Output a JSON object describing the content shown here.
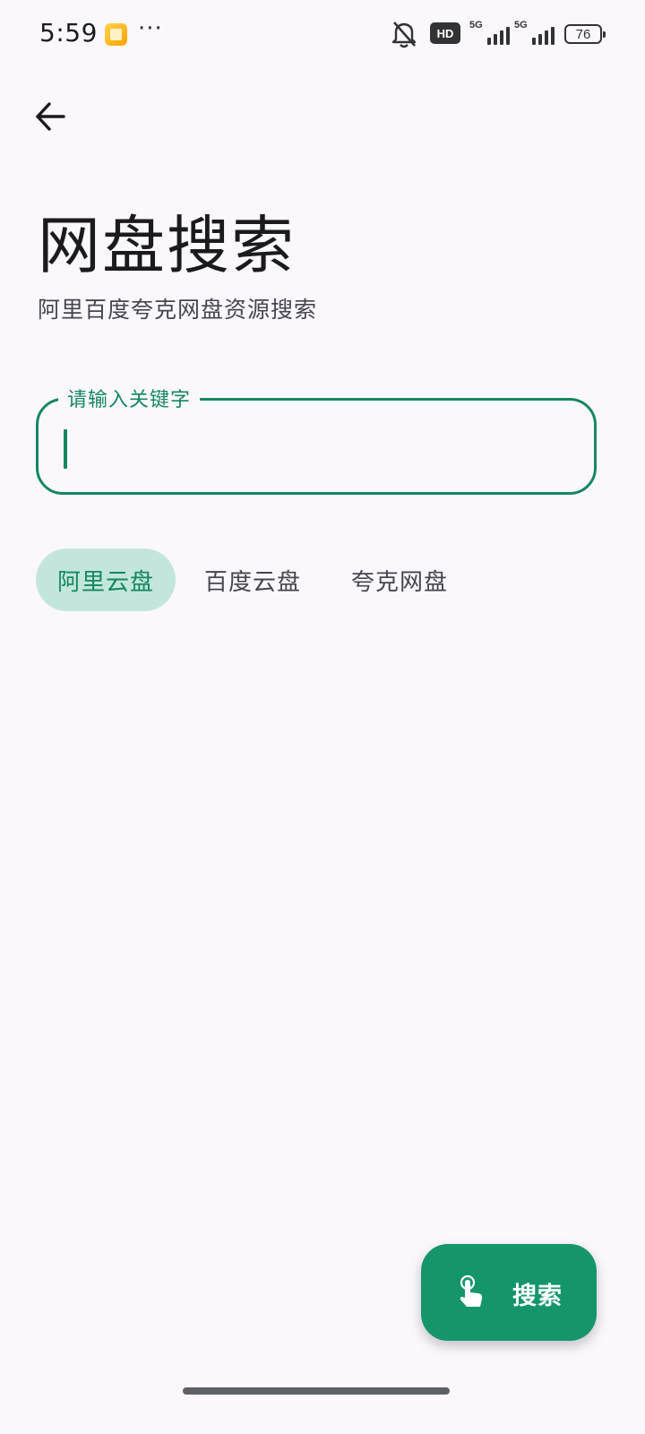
{
  "status_bar": {
    "time": "5:59",
    "more": "···",
    "hd_label": "HD",
    "signal1_label": "5G",
    "signal2_label": "5G",
    "battery_level": "76"
  },
  "header": {
    "back_icon": "arrow-left-icon",
    "title": "网盘搜索",
    "subtitle": "阿里百度夸克网盘资源搜索"
  },
  "search": {
    "label": "请输入关键字",
    "value": ""
  },
  "filters": {
    "selected": "阿里云盘",
    "items": [
      {
        "label": "阿里云盘",
        "selected": true
      },
      {
        "label": "百度云盘",
        "selected": false
      },
      {
        "label": "夸克网盘",
        "selected": false
      }
    ]
  },
  "fab": {
    "icon": "touch-hand-icon",
    "label": "搜索"
  },
  "colors": {
    "accent": "#15875F",
    "fab_bg": "#15966A",
    "chip_selected_bg": "#C3E6DC",
    "background": "#FBF8FD"
  }
}
